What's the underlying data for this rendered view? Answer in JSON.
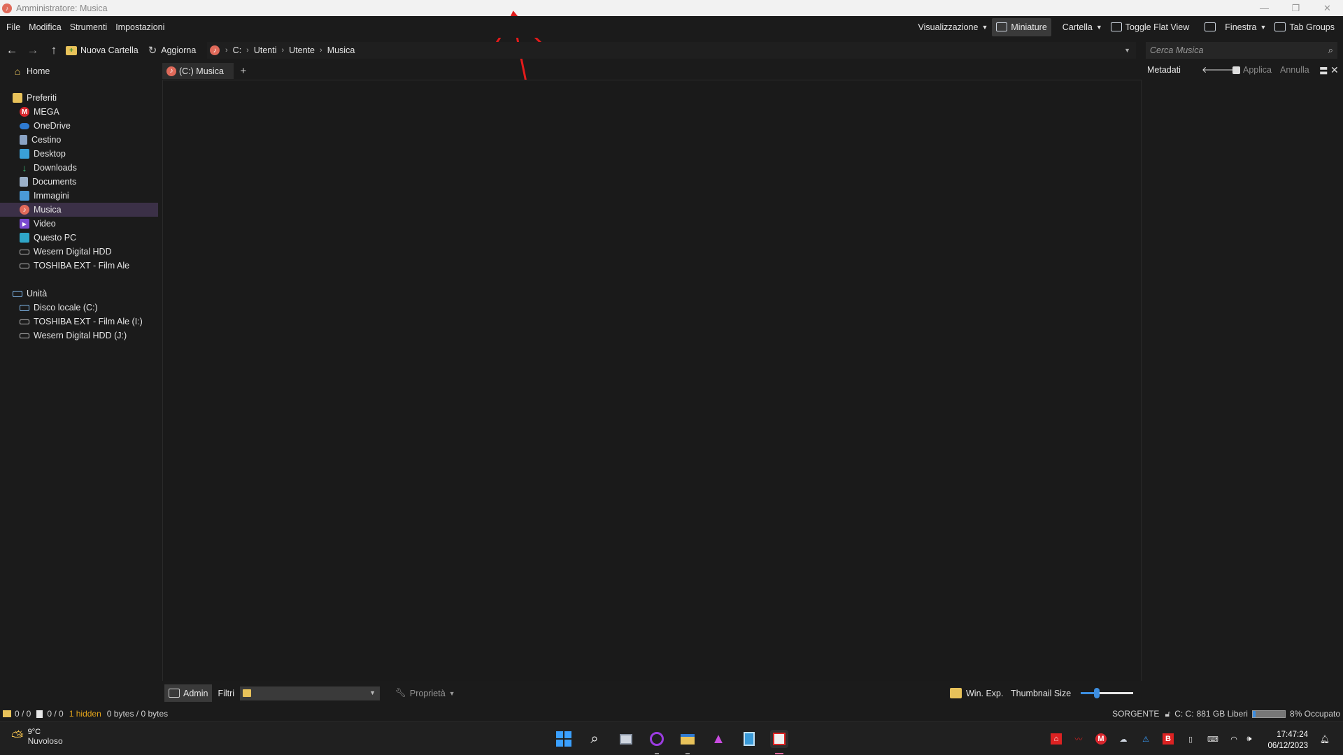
{
  "window": {
    "title": "Amministratore: Musica"
  },
  "menu": {
    "file": "File",
    "modifica": "Modifica",
    "strumenti": "Strumenti",
    "impostazioni": "Impostazioni",
    "visualizzazione": "Visualizzazione",
    "miniature": "Miniature",
    "cartella": "Cartella",
    "toggle_flat_view": "Toggle Flat View",
    "finestra": "Finestra",
    "tab_groups": "Tab Groups"
  },
  "toolbar": {
    "new_folder": "Nuova Cartella",
    "refresh": "Aggiorna"
  },
  "breadcrumb": [
    "C:",
    "Utenti",
    "Utente",
    "Musica"
  ],
  "search": {
    "placeholder": "Cerca Musica"
  },
  "sidebar": {
    "home": "Home",
    "favorites_header": "Preferiti",
    "favorites": [
      "MEGA",
      "OneDrive",
      "Cestino",
      "Desktop",
      "Downloads",
      "Documents",
      "Immagini",
      "Musica",
      "Video",
      "Questo PC",
      "Wesern Digital HDD",
      "TOSHIBA EXT - Film Ale"
    ],
    "drives_header": "Unità",
    "drives": [
      "Disco locale (C:)",
      "TOSHIBA EXT - Film Ale (I:)",
      "Wesern Digital HDD (J:)"
    ],
    "selected": "Musica"
  },
  "tabs": [
    {
      "label": "(C:) Musica"
    }
  ],
  "tab_add": "+",
  "metadata_panel": {
    "title": "Metadati",
    "apply": "Applica",
    "cancel": "Annulla"
  },
  "bottombar": {
    "admin": "Admin",
    "filters": "Filtri",
    "properties": "Proprietà",
    "win_exp": "Win. Exp.",
    "thumbnail_size": "Thumbnail Size",
    "thumbnail_level": 0.3
  },
  "status": {
    "folders": "0 / 0",
    "files": "0 / 0",
    "hidden": "1 hidden",
    "bytes": "0 bytes / 0 bytes",
    "source": "SORGENTE",
    "drive": "C: C:",
    "free": "881 GB Liberi",
    "used": "8% Occupato",
    "used_fraction": 0.08
  },
  "weather": {
    "temp": "9°C",
    "desc": "Nuvoloso"
  },
  "clock": {
    "time": "17:47:24",
    "date": "06/12/2023"
  },
  "colors": {
    "selection": "#3b3047",
    "accent": "#3d8ee0",
    "annotation": "#e21b1b",
    "hidden_text": "#e0a21b"
  }
}
